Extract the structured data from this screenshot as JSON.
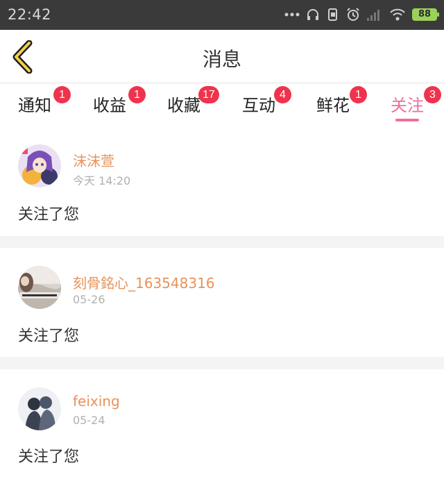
{
  "status_bar": {
    "time": "22:42",
    "battery": "88",
    "icons": [
      "dots-icon",
      "headset-icon",
      "screen-rotate-icon",
      "alarm-icon",
      "signal-icon",
      "wifi-icon",
      "battery-icon"
    ],
    "battery_color": "#9bd15a"
  },
  "header": {
    "title": "消息",
    "back_icon": "chevron-left-icon",
    "back_icon_color": "#f2d14a"
  },
  "tabs": [
    {
      "label": "通知",
      "badge": "1",
      "active": false
    },
    {
      "label": "收益",
      "badge": "1",
      "active": false
    },
    {
      "label": "收藏",
      "badge": "17",
      "active": false
    },
    {
      "label": "互动",
      "badge": "4",
      "active": false
    },
    {
      "label": "鲜花",
      "badge": "1",
      "active": false
    },
    {
      "label": "关注",
      "badge": "3",
      "active": true
    }
  ],
  "colors": {
    "accent": "#ee6e9f",
    "badge": "#f0334d",
    "username": "#e8925b"
  },
  "messages": [
    {
      "user": "沫沫萱",
      "time": "今天 14:20",
      "text": "关注了您"
    },
    {
      "user": "刻骨銘心_163548316",
      "time": "05-26",
      "text": "关注了您"
    },
    {
      "user": "feixing",
      "time": "05-24",
      "text": "关注了您"
    }
  ]
}
